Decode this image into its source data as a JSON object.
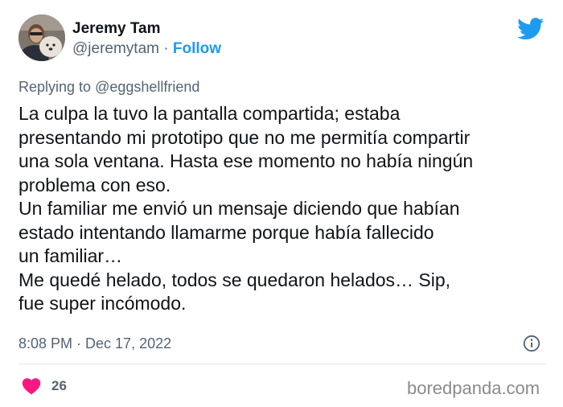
{
  "author": {
    "name": "Jeremy Tam",
    "handle": "@jeremytam",
    "separator": "·",
    "follow_label": "Follow"
  },
  "reply": {
    "prefix": "Replying to",
    "mention": "@eggshellfriend"
  },
  "tweet": {
    "text": "La culpa la tuvo la pantalla compartida; estaba\npresentando mi prototipo que no me permitía compartir\nuna sola ventana. Hasta ese momento no había ningún\nproblema con eso.\nUn familiar me envió un mensaje diciendo que habían\nestado intentando llamarme porque había fallecido\nun familiar…\nMe quedé helado, todos se quedaron helados… Sip,\nfue super incómodo."
  },
  "meta": {
    "timestamp": "8:08 PM · Dec 17, 2022"
  },
  "engagement": {
    "likes": "26"
  },
  "watermark": "boredpanda.com",
  "icons": {
    "brand": "twitter-bird-icon",
    "info": "info-icon",
    "like": "heart-icon"
  },
  "colors": {
    "link": "#1d9bf0",
    "heart": "#f91880",
    "secondary_text": "#536471"
  }
}
